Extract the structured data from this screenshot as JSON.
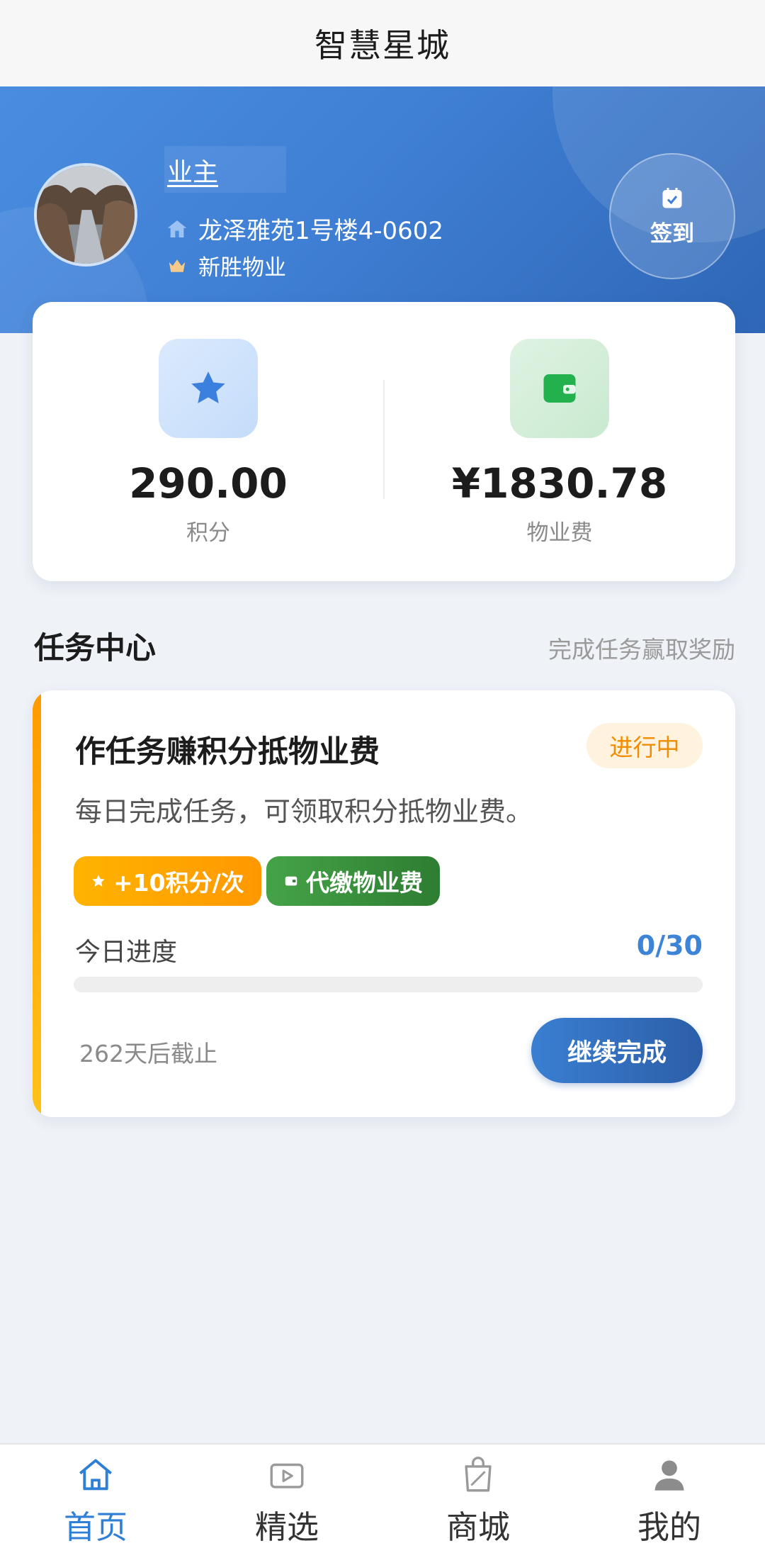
{
  "app": {
    "title": "智慧星城"
  },
  "profile": {
    "name": "业主",
    "address": "龙泽雅苑1号楼4-0602",
    "company": "新胜物业",
    "checkin_label": "签到"
  },
  "stats": {
    "points_value": "290.00",
    "points_label": "积分",
    "fee_value": "¥1830.78",
    "fee_label": "物业费"
  },
  "tasks_section": {
    "title": "任务中心",
    "hint": "完成任务赢取奖励"
  },
  "task": {
    "title": "作任务赚积分抵物业费",
    "status": "进行中",
    "description": "每日完成任务，可领取积分抵物业费。",
    "tag_points": "+10积分/次",
    "tag_fee": "代缴物业费",
    "progress_label": "今日进度",
    "progress_text": "0/30",
    "progress_fraction": 0,
    "deadline": "262天后截止",
    "action_label": "继续完成"
  },
  "bottom_nav": {
    "items": [
      {
        "label": "首页",
        "icon": "home-icon",
        "active": true
      },
      {
        "label": "精选",
        "icon": "video-icon",
        "active": false
      },
      {
        "label": "商城",
        "icon": "shopping-bag-icon",
        "active": false
      },
      {
        "label": "我的",
        "icon": "user-icon",
        "active": false
      }
    ]
  },
  "colors": {
    "accent_blue": "#3d84d6",
    "header_gradient_start": "#4a8de0",
    "header_gradient_end": "#2f66b6",
    "status_orange": "#f08c00",
    "fee_green": "#2e7d32"
  }
}
